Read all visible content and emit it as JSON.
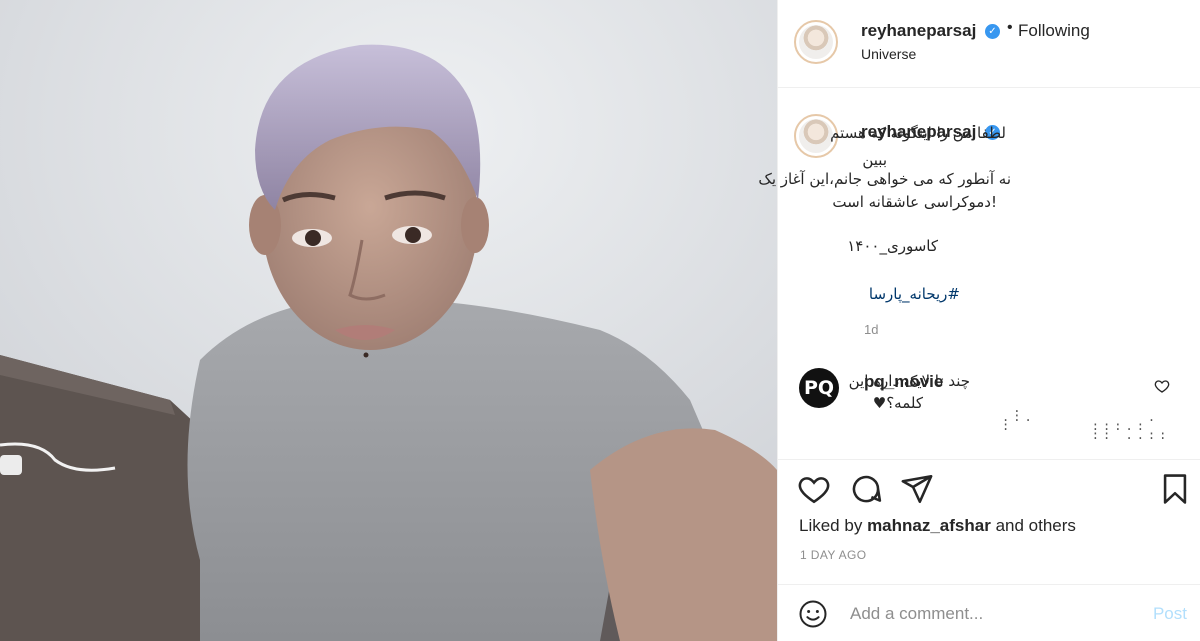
{
  "post": {
    "username": "reyhaneparsaj",
    "verified": true,
    "follow_separator": "•",
    "follow_state": "Following",
    "location": "Universe"
  },
  "caption": {
    "username": "reyhaneparsaj",
    "lines": [
      "لطفا من را اینگونه که هستم",
      "ببین",
      "نه آنطور که می خواهی جانم،این آغاز یک",
      "!دموکراسی عاشقانه است",
      "کاسوری_۱۴۰۰"
    ],
    "hashtag": "#ریحانه_پارسا",
    "time": "1d"
  },
  "comment": {
    "avatar_text": "PQ",
    "username": "pq_movie",
    "line1": "چند تا لایک داره این",
    "line2": "کلمه؟♥",
    "dots": " .\n.:.          .\n:       :::.:\n        :: ..::"
  },
  "actions": {
    "icons": [
      "heart-icon",
      "comment-icon",
      "share-icon",
      "bookmark-icon"
    ]
  },
  "likes": {
    "prefix": "Liked by",
    "user": "mahnaz_afshar",
    "suffix": "and others"
  },
  "post_time": "1 DAY AGO",
  "add_comment": {
    "placeholder": "Add a comment...",
    "post_label": "Post"
  },
  "colors": {
    "verified_blue": "#3897f0",
    "hashtag_blue": "#00376b",
    "post_disabled": "#b2dffc",
    "hair_lavender": "#b3a7c8"
  }
}
